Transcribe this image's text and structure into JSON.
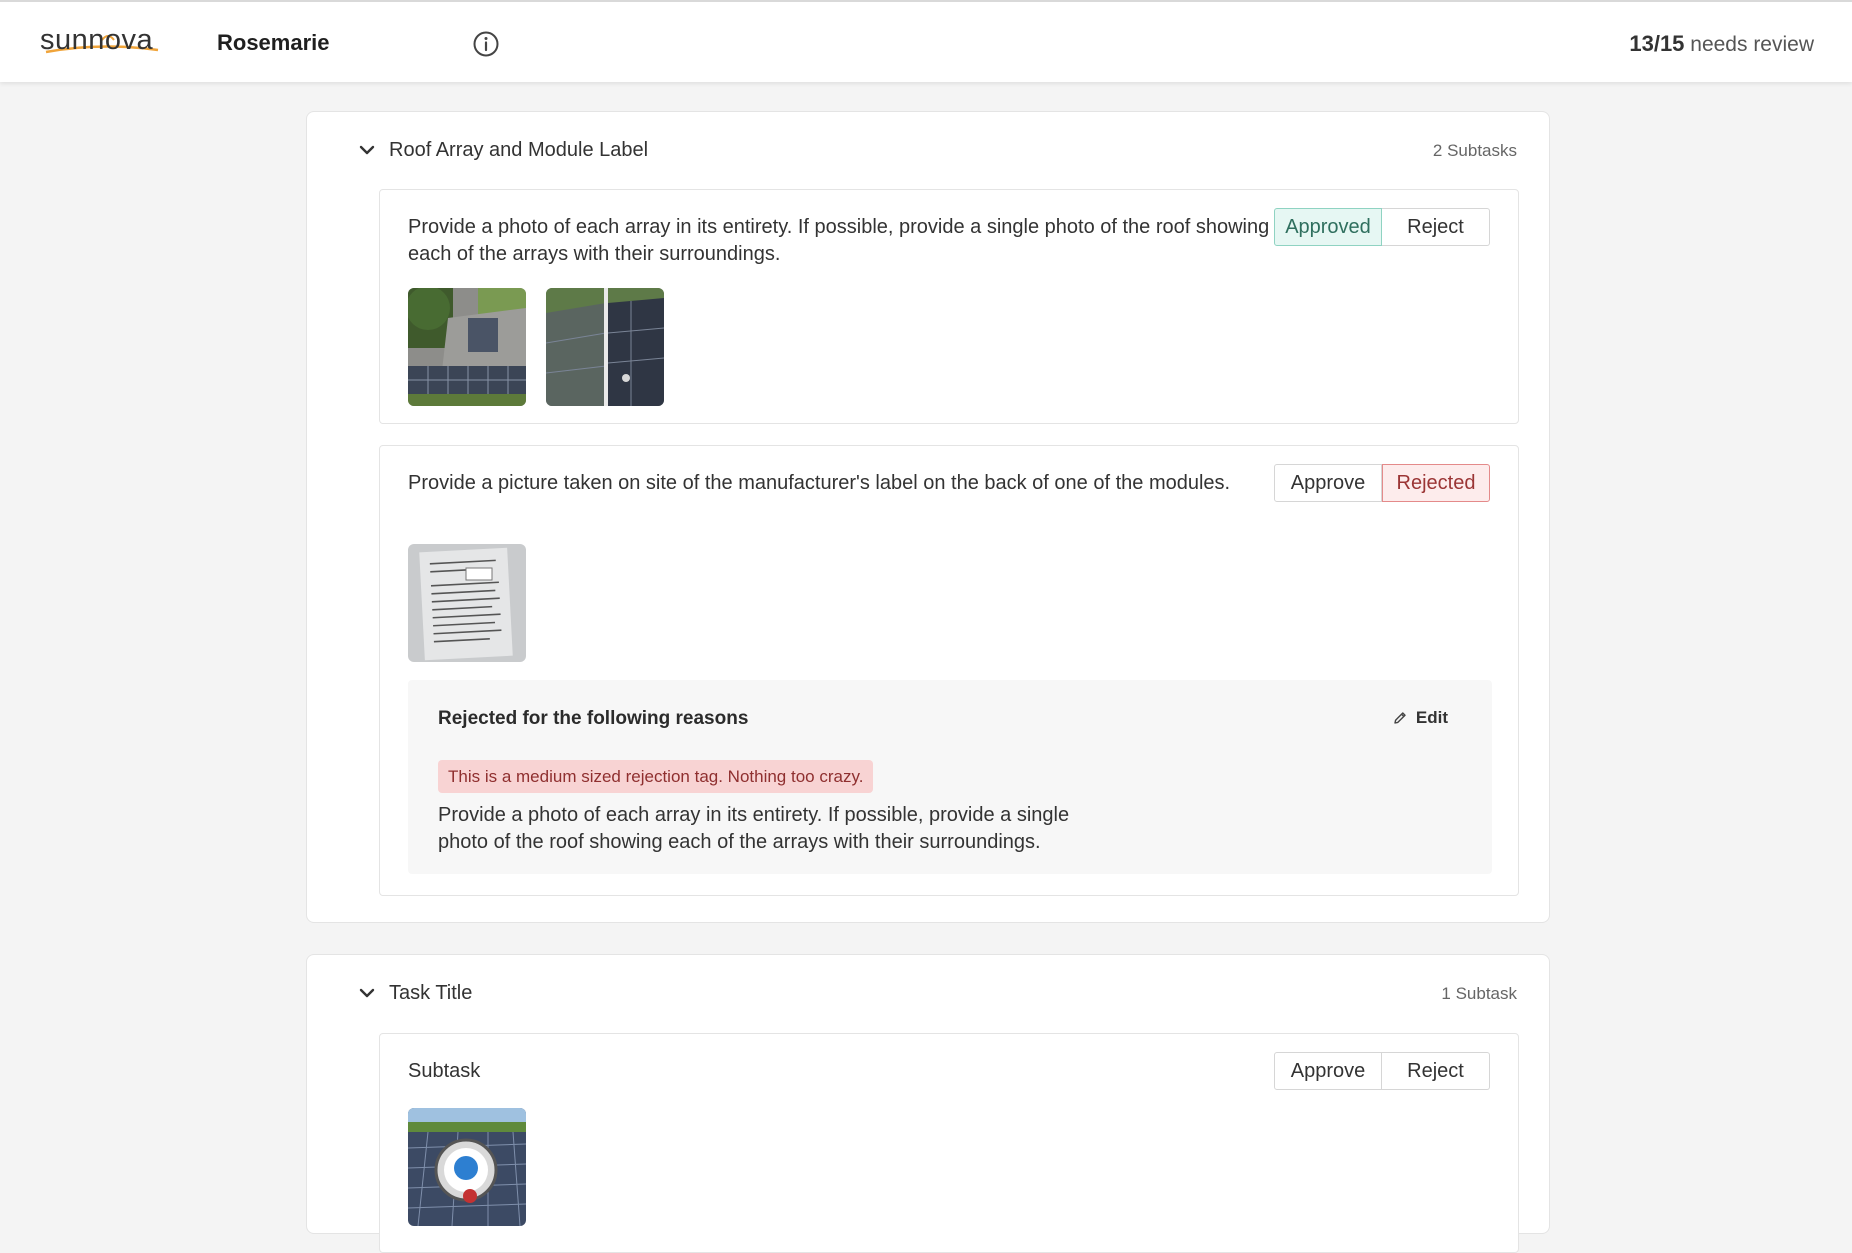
{
  "header": {
    "brand": "sunnova",
    "user_name": "Rosemarie",
    "review_count": "13/15",
    "review_label": "needs review",
    "icons": {
      "info": "info-circle-icon"
    }
  },
  "tasks": [
    {
      "title": "Roof Array and Module Label",
      "subtask_count": "2 Subtasks",
      "subtasks": [
        {
          "description": "Provide a photo of each array in its entirety. If possible, provide a single photo of the roof showing each of the arrays with their surroundings.",
          "approve_label": "Approved",
          "reject_label": "Reject",
          "status": "approved"
        },
        {
          "description": "Provide a picture taken on site of the manufacturer's label on the back of one of the modules.",
          "approve_label": "Approve",
          "reject_label": "Rejected",
          "status": "rejected",
          "rejection": {
            "title": "Rejected for the following reasons",
            "edit_label": "Edit",
            "tag": "This is a medium sized rejection tag. Nothing too crazy.",
            "note": "Provide a photo of each array in its entirety. If possible, provide a single photo of the roof showing each of the arrays with their surroundings."
          }
        }
      ]
    },
    {
      "title": "Task Title",
      "subtask_count": "1 Subtask",
      "subtasks": [
        {
          "description": "Subtask",
          "approve_label": "Approve",
          "reject_label": "Reject",
          "status": "pending"
        }
      ]
    }
  ],
  "colors": {
    "approved_bg": "#e6f7f3",
    "approved_border": "#8fd3c2",
    "rejected_bg": "#fdecec",
    "rejected_border": "#e48a8a",
    "tag_bg": "#f8d3d3"
  }
}
